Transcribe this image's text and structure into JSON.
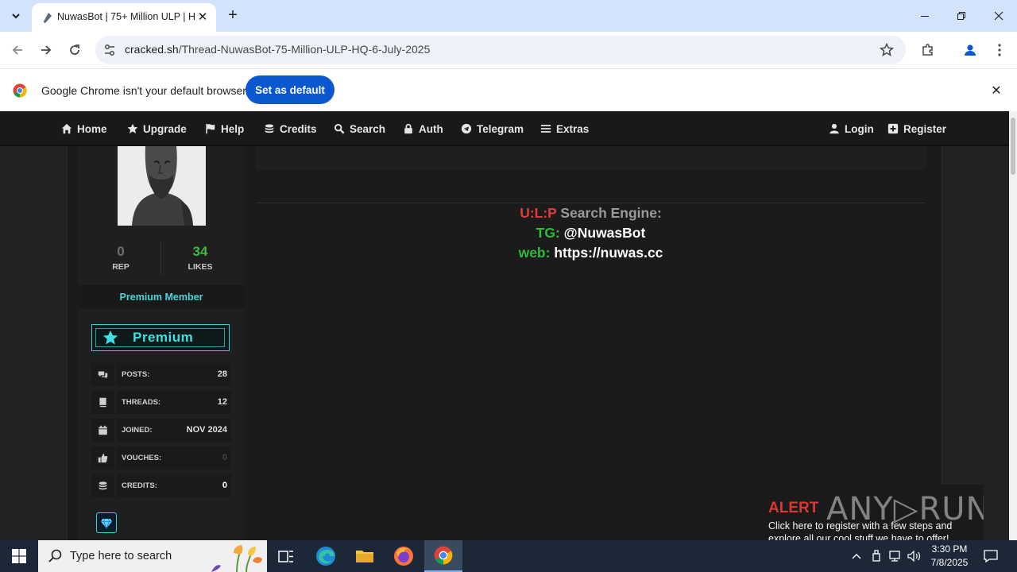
{
  "browser": {
    "tab_title": "NuwasBot | 75+ Million ULP | H",
    "url_host": "cracked.sh",
    "url_path": "/Thread-NuwasBot-75-Million-ULP-HQ-6-July-2025",
    "infobar_message": "Google Chrome isn't your default browser",
    "infobar_button": "Set as default"
  },
  "nav": {
    "left": [
      {
        "label": "Home",
        "icon": "home-icon"
      },
      {
        "label": "Upgrade",
        "icon": "star-icon"
      },
      {
        "label": "Help",
        "icon": "flag-icon"
      },
      {
        "label": "Credits",
        "icon": "coins-icon"
      },
      {
        "label": "Search",
        "icon": "search-icon"
      },
      {
        "label": "Auth",
        "icon": "lock-icon"
      },
      {
        "label": "Telegram",
        "icon": "telegram-icon"
      },
      {
        "label": "Extras",
        "icon": "bars-icon"
      }
    ],
    "right": [
      {
        "label": "Login",
        "icon": "user-icon"
      },
      {
        "label": "Register",
        "icon": "plus-square-icon"
      }
    ]
  },
  "profile": {
    "rep_value": "0",
    "rep_label": "REP",
    "likes_value": "34",
    "likes_label": "LIKES",
    "rank": "Premium Member",
    "badge": "Premium",
    "stats": [
      {
        "key": "POSTS:",
        "value": "28",
        "icon": "comments-icon"
      },
      {
        "key": "THREADS:",
        "value": "12",
        "icon": "book-icon"
      },
      {
        "key": "JOINED:",
        "value": "NOV 2024",
        "icon": "calendar-icon"
      },
      {
        "key": "VOUCHES:",
        "value": "0",
        "icon": "thumbs-up-icon"
      },
      {
        "key": "CREDITS:",
        "value": "0",
        "icon": "coins-icon"
      }
    ]
  },
  "post": {
    "line1_red": "U:L:P",
    "line1_rest": " Search Engine:",
    "line2_label": "TG:",
    "line2_value": " @NuwasBot",
    "line3_label": "web:",
    "line3_value": " https://nuwas.cc"
  },
  "anyrun": {
    "alert": "ALERT",
    "brand": "ANY▷RUN",
    "text": "Click here to register with a few steps and explore all our cool stuff we have to offer!"
  },
  "taskbar": {
    "search_placeholder": "Type here to search",
    "time": "3:30 PM",
    "date": "7/8/2025"
  },
  "colors": {
    "accent_teal": "#3de0e8",
    "rep_gray": "#6f6f6f",
    "likes_green": "#3dbb3d",
    "ulp_red": "#e23b3b",
    "tg_green": "#2ebd3a",
    "chrome_blue": "#0b57d0"
  }
}
